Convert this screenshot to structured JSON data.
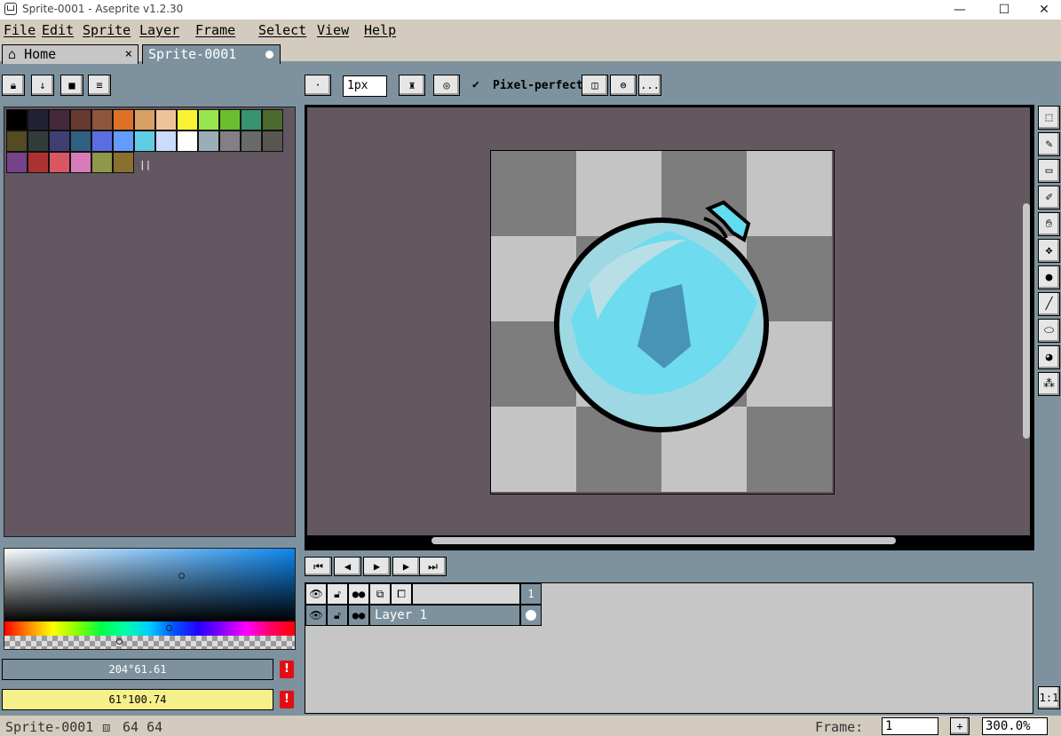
{
  "window": {
    "title": "Sprite-0001 - Aseprite v1.2.30",
    "controls": {
      "minimize": "—",
      "maximize": "☐",
      "close": "✕"
    }
  },
  "menu": [
    "File",
    "Edit",
    "Sprite",
    "Layer",
    "Frame",
    "Select",
    "View",
    "Help"
  ],
  "tabs": {
    "home_label": "Home",
    "home_close": "×",
    "sprite_label": "Sprite-0001"
  },
  "toolbar": {
    "brush_size": "1px",
    "pixel_perfect_label": "Pixel-perfect",
    "pixel_perfect_checked": true,
    "more": "..."
  },
  "palette": {
    "colors": [
      "#000000",
      "#222034",
      "#45283c",
      "#663931",
      "#8f563b",
      "#df7126",
      "#d9a066",
      "#eec39a",
      "#fbf236",
      "#99e550",
      "#6abe30",
      "#37946e",
      "#4b692f",
      "#524b24",
      "#323c39",
      "#3f3f74",
      "#306082",
      "#5b6ee1",
      "#639bff",
      "#5fcde4",
      "#cbdbfc",
      "#ffffff",
      "#9badb7",
      "#847e87",
      "#696a6a",
      "#595652",
      "#76428a",
      "#ac3232",
      "#d95763",
      "#d77bba",
      "#8f974a",
      "#8a6f30"
    ],
    "resize_handle": "||"
  },
  "colors": {
    "foreground_value": "204°61.61",
    "background_value": "61°100.74",
    "foreground_bar": "#7d929e",
    "background_bar": "#f6f08c",
    "warning": "!"
  },
  "timeline": {
    "frame_number": "1",
    "layer_name": "Layer 1"
  },
  "status": {
    "sprite_name": "Sprite-0001",
    "size": "64 64",
    "frame_label": "Frame:",
    "frame_value": "1",
    "add_frame": "+",
    "zoom": "300.0%",
    "zoom_reset": "1:1"
  }
}
